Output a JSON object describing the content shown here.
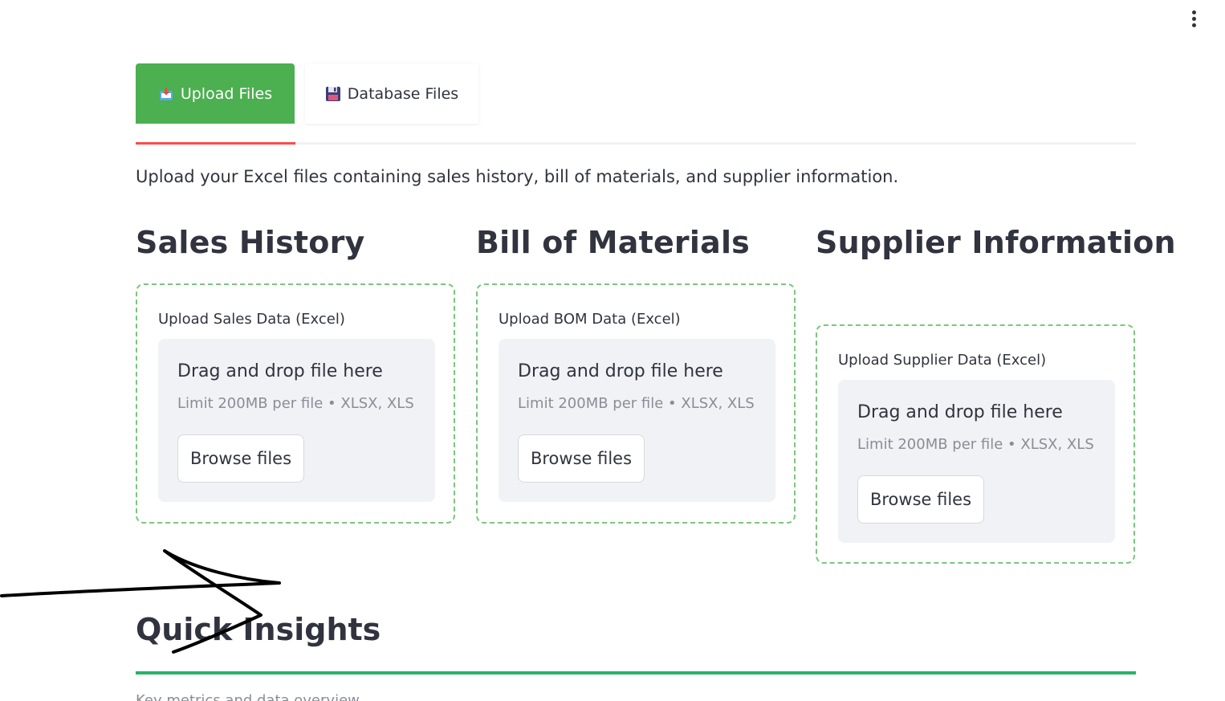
{
  "tabs": [
    {
      "label": "Upload Files",
      "icon": "inbox-tray-icon",
      "active": true
    },
    {
      "label": "Database Files",
      "icon": "floppy-disk-icon",
      "active": false
    }
  ],
  "intro_text": "Upload your Excel files containing sales history, bill of materials, and supplier information.",
  "sections": [
    {
      "heading": "Sales History",
      "uploader_label": "Upload Sales Data (Excel)",
      "drop_text": "Drag and drop file here",
      "limit_text": "Limit 200MB per file • XLSX, XLS",
      "button_label": "Browse files"
    },
    {
      "heading": "Bill of Materials",
      "uploader_label": "Upload BOM Data (Excel)",
      "drop_text": "Drag and drop file here",
      "limit_text": "Limit 200MB per file • XLSX, XLS",
      "button_label": "Browse files"
    },
    {
      "heading": "Supplier Information",
      "uploader_label": "Upload Supplier Data (Excel)",
      "drop_text": "Drag and drop file here",
      "limit_text": "Limit 200MB per file • XLSX, XLS",
      "button_label": "Browse files"
    }
  ],
  "insights": {
    "title": "Quick Insights",
    "subtitle": "Key metrics and data overview"
  },
  "colors": {
    "active_tab": "#4caf50",
    "tab_highlight": "#ff4b4b",
    "dashed_border": "#7bc67e",
    "insights_rule": "#28b463"
  }
}
